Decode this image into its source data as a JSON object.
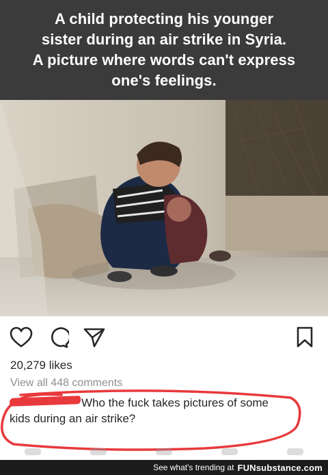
{
  "header": {
    "lines": [
      "A child protecting his younger",
      "sister during an air strike in Syria.",
      "A picture where words can't express",
      "one's feelings."
    ]
  },
  "post": {
    "likes": "20,279 likes",
    "view_comments": "View all 448 comments",
    "comment_text": "Who the fuck takes pictures of some kids during an air strike?"
  },
  "footer": {
    "trending_text": "See what's trending at",
    "brand": "FUNsubstance.com"
  },
  "colors": {
    "banner_bg": "#3b3b3b",
    "annotation_red": "#e8393c",
    "footer_bg": "#1c1c1c"
  },
  "icons": [
    "heart-icon",
    "comment-icon",
    "share-icon",
    "bookmark-icon"
  ]
}
